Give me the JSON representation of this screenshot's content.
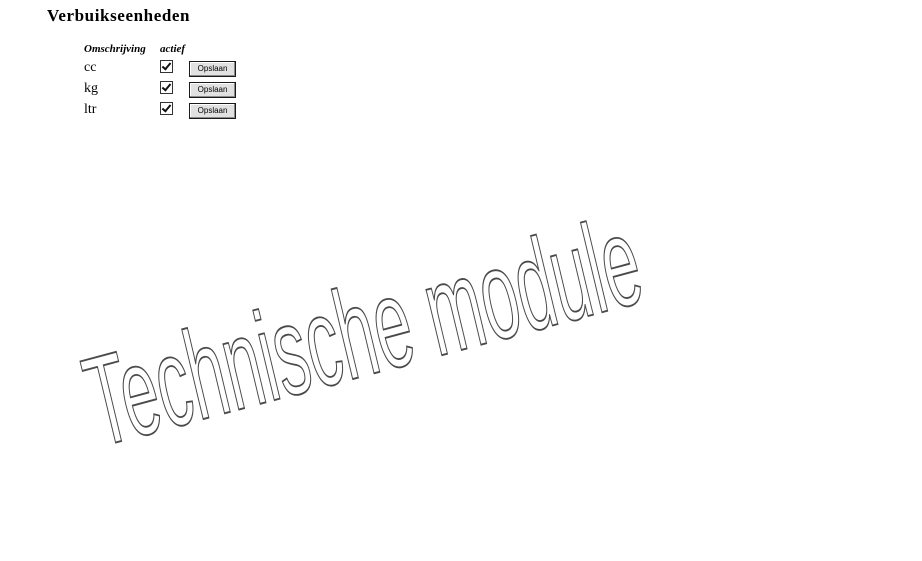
{
  "page": {
    "title": "Verbuikseenheden"
  },
  "table": {
    "headers": {
      "description": "Omschrijving",
      "active": "actief"
    },
    "rows": [
      {
        "description": "cc",
        "active": true,
        "save_label": "Opslaan"
      },
      {
        "description": "kg",
        "active": true,
        "save_label": "Opslaan"
      },
      {
        "description": "ltr",
        "active": true,
        "save_label": "Opslaan"
      }
    ]
  },
  "watermark": {
    "text": "Technische module"
  }
}
